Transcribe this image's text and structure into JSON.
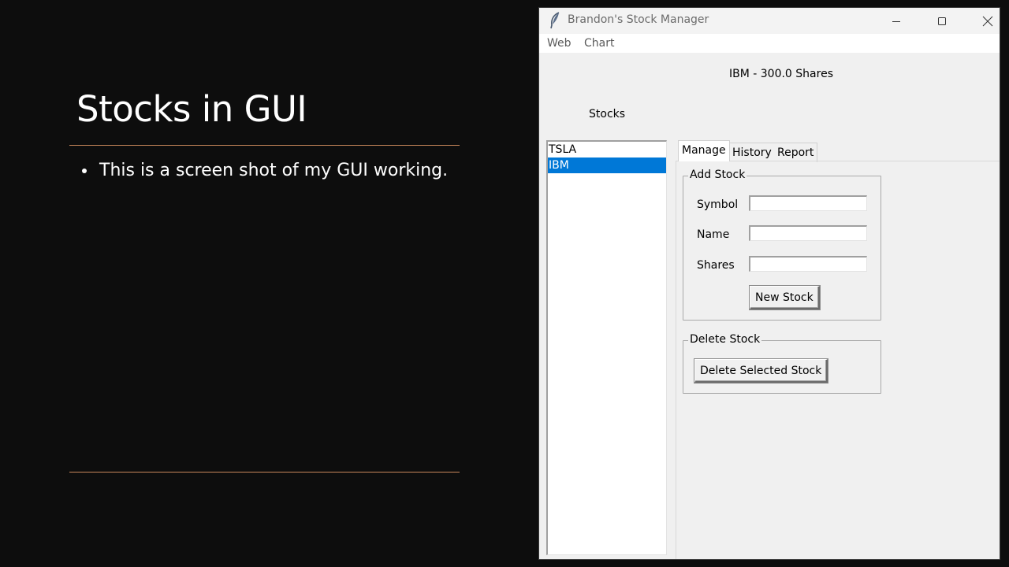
{
  "slide": {
    "title": "Stocks in GUI",
    "bullets": [
      "This is a screen shot of my GUI working."
    ]
  },
  "window": {
    "title": "Brandon's Stock Manager",
    "menu": [
      "Web",
      "Chart"
    ],
    "header": "IBM - 300.0 Shares",
    "stocks_label": "Stocks",
    "stock_list": [
      {
        "symbol": "TSLA",
        "selected": false
      },
      {
        "symbol": "IBM",
        "selected": true
      }
    ],
    "tabs": [
      {
        "label": "Manage",
        "active": true
      },
      {
        "label": "History",
        "active": false
      },
      {
        "label": "Report",
        "active": false
      }
    ],
    "add_stock": {
      "group_label": "Add Stock",
      "symbol_label": "Symbol",
      "symbol_value": "",
      "name_label": "Name",
      "name_value": "",
      "shares_label": "Shares",
      "shares_value": "",
      "button": "New Stock"
    },
    "delete_stock": {
      "group_label": "Delete Stock",
      "button": "Delete Selected Stock"
    }
  },
  "colors": {
    "slide_bg": "#0d0d0d",
    "accent_rule": "#c8875a",
    "selection": "#0078d7"
  }
}
